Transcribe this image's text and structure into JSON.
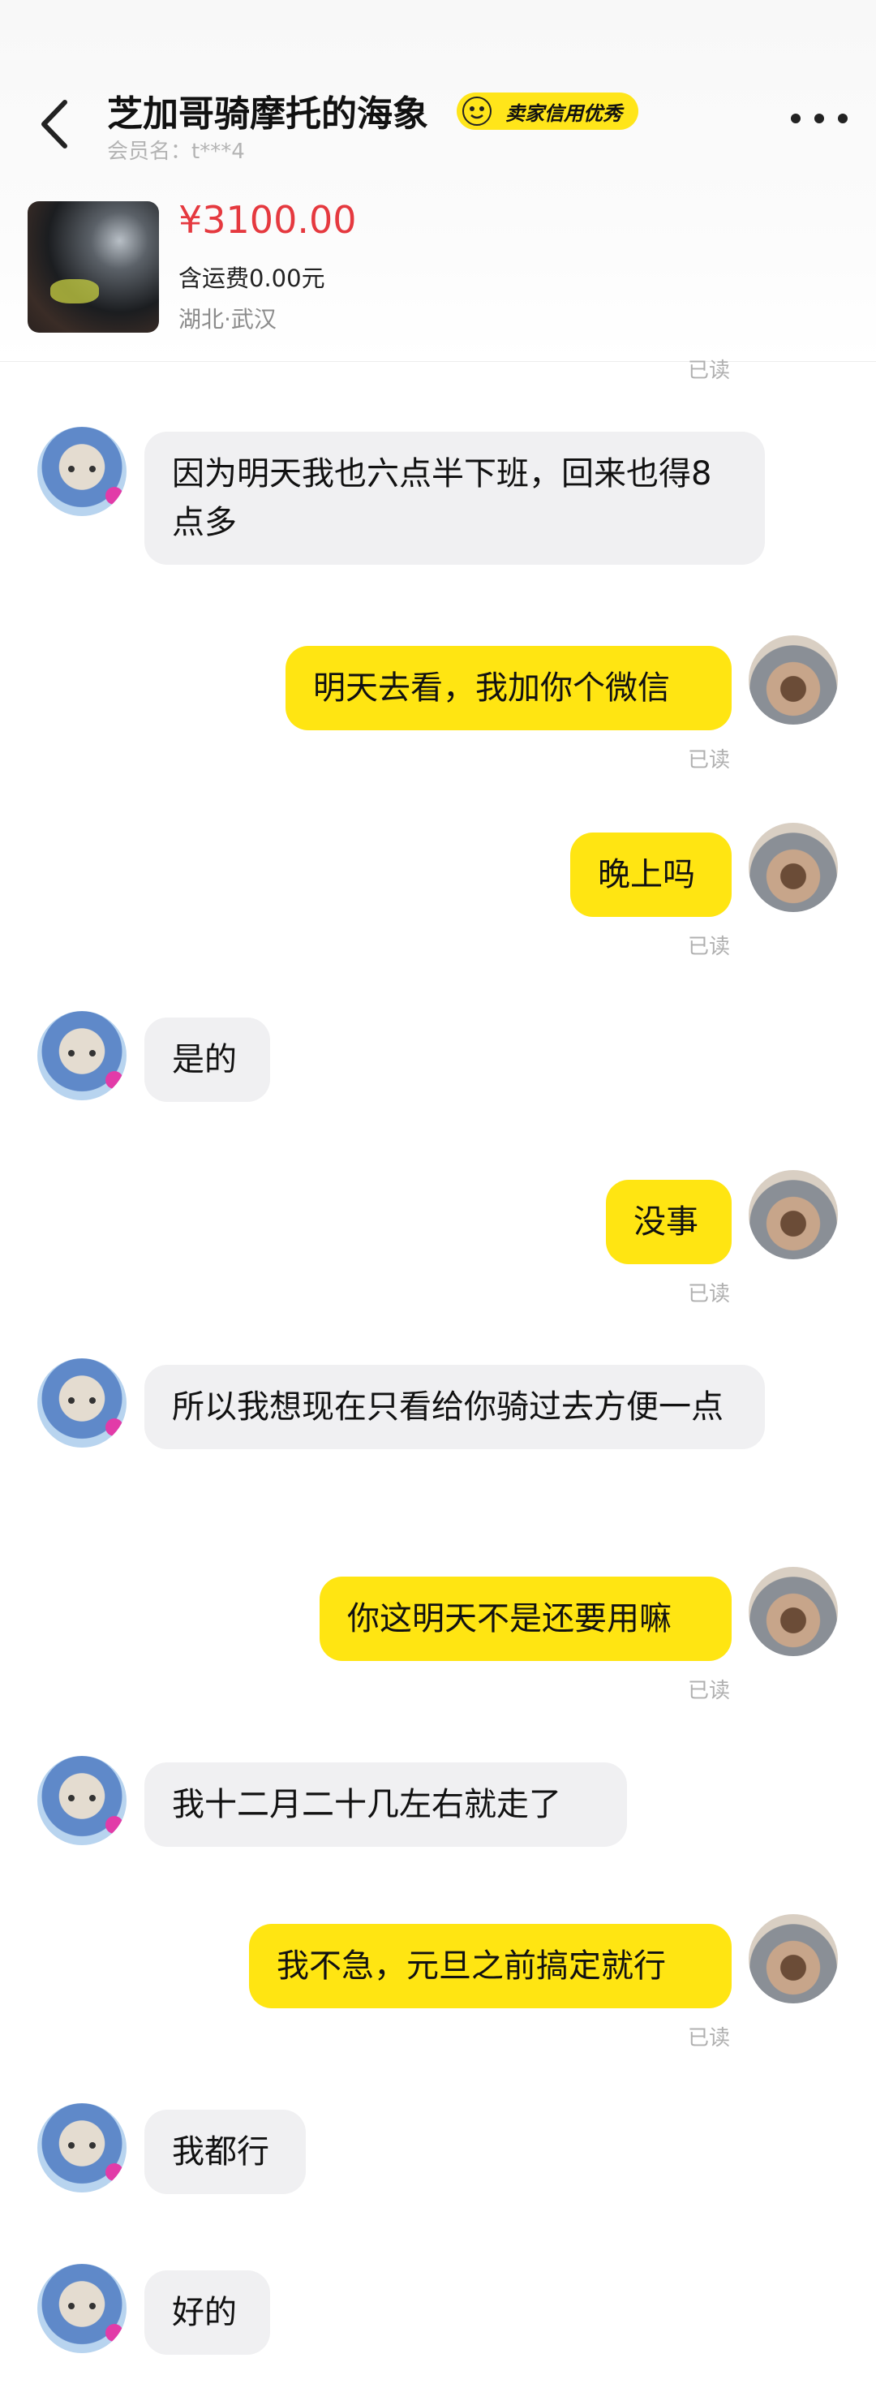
{
  "header": {
    "title": "芝加哥骑摩托的海象",
    "badge": "卖家信用优秀",
    "member": "会员名：t***4"
  },
  "product": {
    "price": "¥3100.00",
    "shipping": "含运费0.00元",
    "location": "湖北·武汉"
  },
  "chat": {
    "cut_read": "已读",
    "messages": [
      {
        "side": "left",
        "text": "因为明天我也六点半下班，回来也得8点多"
      },
      {
        "side": "right",
        "text": "明天去看，我加你个微信",
        "status": "已读"
      },
      {
        "side": "right",
        "text": "晚上吗",
        "status": "已读"
      },
      {
        "side": "left",
        "text": "是的"
      },
      {
        "side": "right",
        "text": "没事",
        "status": "已读"
      },
      {
        "side": "left",
        "text": "所以我想现在只看给你骑过去方便一点"
      },
      {
        "side": "right",
        "text": "你这明天不是还要用嘛",
        "status": "已读"
      },
      {
        "side": "left",
        "text": "我十二月二十几左右就走了"
      },
      {
        "side": "right",
        "text": "我不急，元旦之前搞定就行",
        "status": "已读"
      },
      {
        "side": "left",
        "text": "我都行"
      },
      {
        "side": "left",
        "text": "好的"
      }
    ]
  }
}
